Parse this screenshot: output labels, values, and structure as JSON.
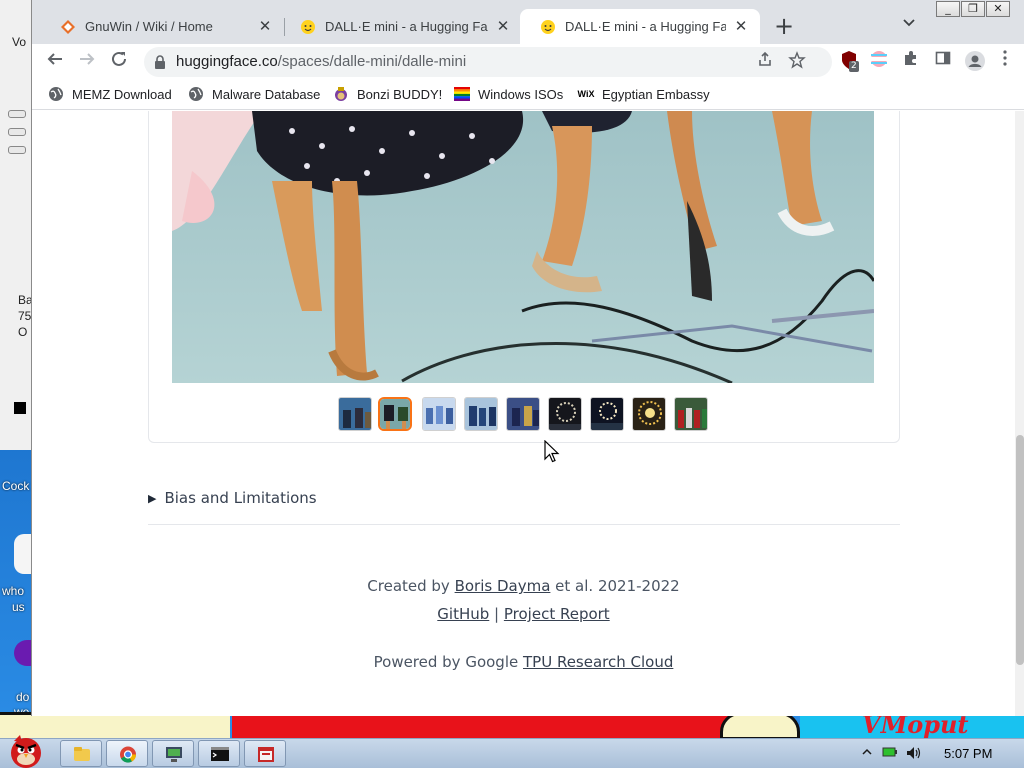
{
  "window": {
    "controls": [
      "_",
      "❐",
      "✕"
    ]
  },
  "tabs": [
    {
      "title": "GnuWin / Wiki / Home",
      "close": "✕"
    },
    {
      "title": "DALL·E mini - a Hugging Face",
      "close": "✕"
    },
    {
      "title": "DALL·E mini - a Hugging Face",
      "close": "✕",
      "active": true
    }
  ],
  "toolbar": {
    "url_host": "huggingface.co",
    "url_path": "/spaces/dalle-mini/dalle-mini",
    "extension_badge": "2"
  },
  "bookmarks": [
    {
      "label": "MEMZ Download",
      "icon": "globe-icon"
    },
    {
      "label": "Malware Database",
      "icon": "globe-icon"
    },
    {
      "label": "Bonzi BUDDY!",
      "icon": "bonzi-icon"
    },
    {
      "label": "Windows ISOs",
      "icon": "rainbow-flag-icon"
    },
    {
      "label": "Egyptian Embassy",
      "icon": "wix-icon"
    }
  ],
  "wix_logo_text": "WiX",
  "page": {
    "gallery": {
      "thumbnail_count": 9,
      "selected_index": 1
    },
    "details_summary": "Bias and Limitations",
    "footer": {
      "created_prefix": "Created by ",
      "author": "Boris Dayma",
      "created_suffix": " et al. 2021-2022",
      "github": "GitHub",
      "separator": " | ",
      "report": "Project Report",
      "powered_prefix": "Powered by Google ",
      "tpu": "TPU Research Cloud"
    }
  },
  "desktop": {
    "labels": [
      "Cock",
      "who",
      "us",
      "do",
      "we"
    ],
    "bg_app_text": [
      "Vo",
      "Ba",
      "75",
      "O"
    ],
    "banner_text": "VMoput"
  },
  "taskbar": {
    "clock": "5:07 PM"
  },
  "colors": {
    "accent": "#f97316",
    "tabstrip": "#dee1e6"
  }
}
